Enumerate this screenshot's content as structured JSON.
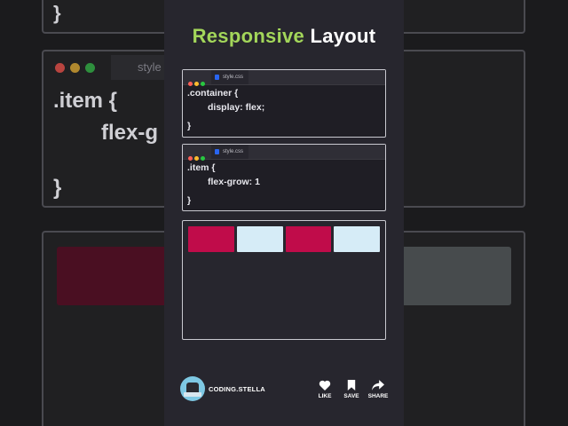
{
  "title": {
    "accent": "Responsive",
    "rest": "Layout"
  },
  "editor1": {
    "tab_label": "style.css",
    "lines": [
      ".container {",
      "display: flex;",
      "}"
    ]
  },
  "editor2": {
    "tab_label": "style.css",
    "lines": [
      ".item {",
      "flex-grow: 1",
      "}"
    ]
  },
  "background": {
    "tab_label": "style",
    "brace_top": "}",
    "code_line1": ".item {",
    "code_line2": "flex-g",
    "brace_bottom": "}"
  },
  "demo": {
    "items": [
      {
        "color": "#c00c4a"
      },
      {
        "color": "#d6ecf7"
      },
      {
        "color": "#c00c4a"
      },
      {
        "color": "#d6ecf7"
      }
    ]
  },
  "colors": {
    "accent_green": "#a3d65a",
    "dot_red": "#ff5f57",
    "dot_yellow": "#febc2e",
    "dot_green": "#28c840"
  },
  "footer": {
    "handle": "CODING.STELLA",
    "like_label": "LIKE",
    "save_label": "SAVE",
    "share_label": "SHARE"
  },
  "icons": [
    "heart-icon",
    "bookmark-icon",
    "share-icon",
    "css3-icon"
  ]
}
